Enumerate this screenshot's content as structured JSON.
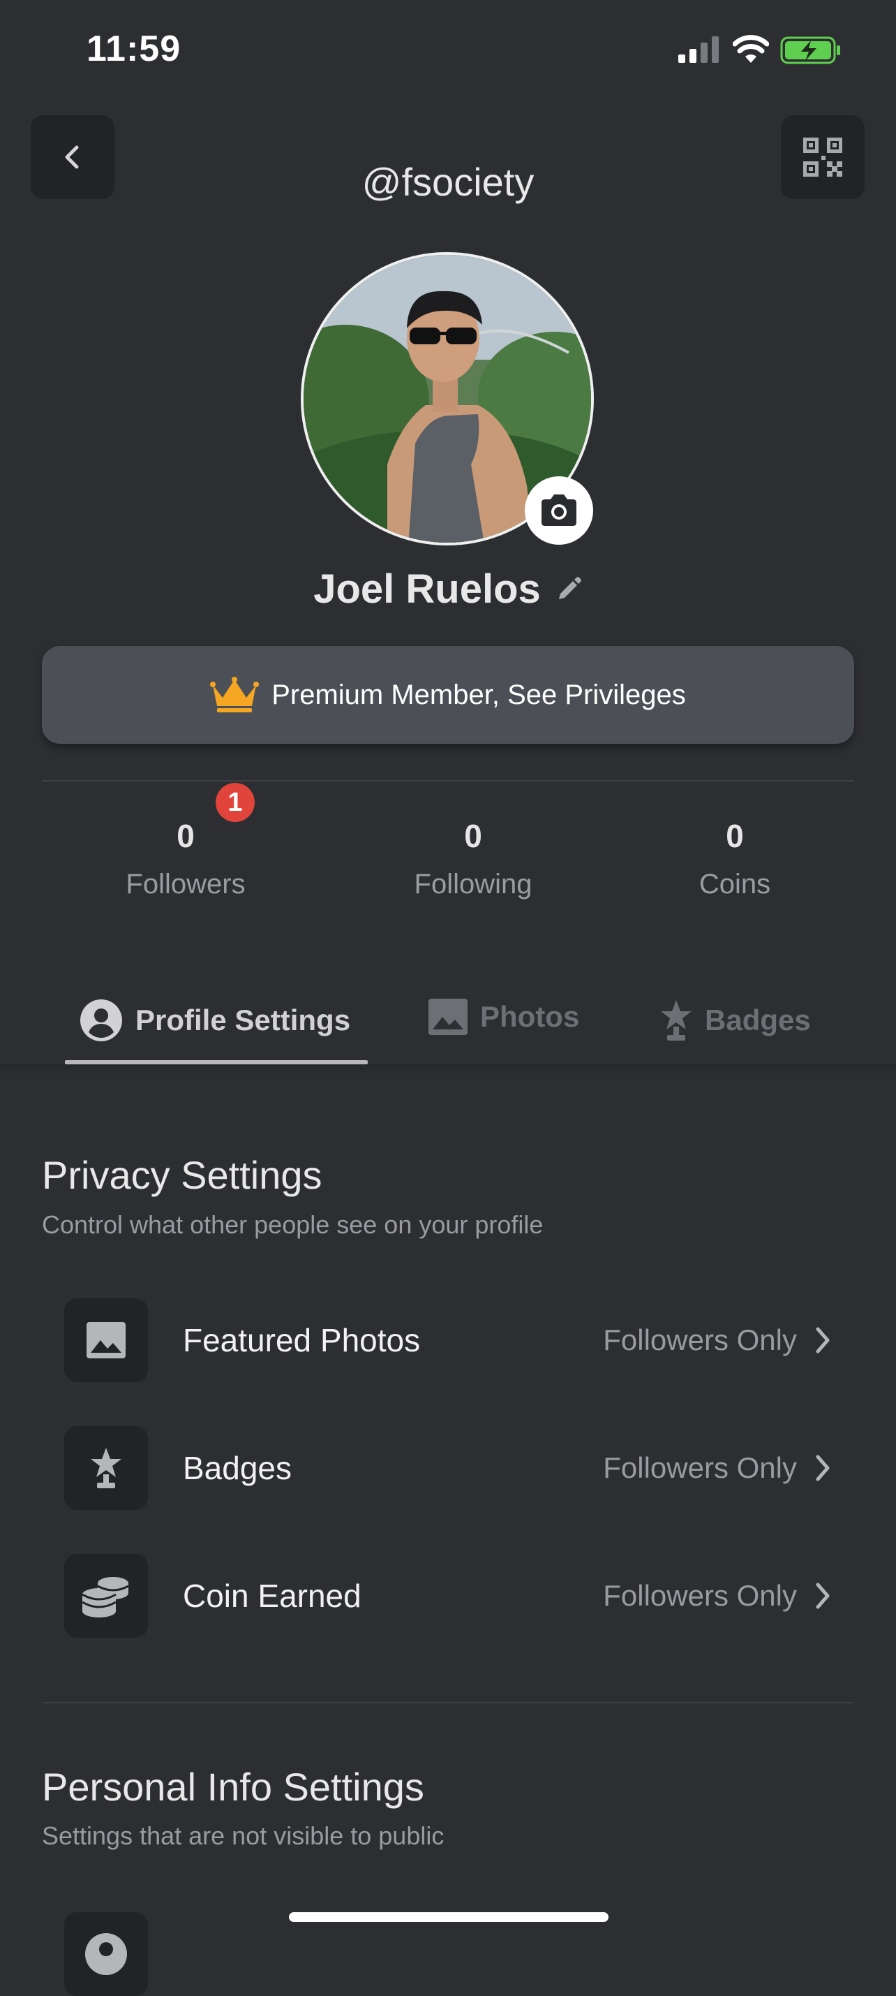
{
  "status_bar": {
    "time": "11:59"
  },
  "header": {
    "username": "@fsociety"
  },
  "profile": {
    "display_name": "Joel Ruelos"
  },
  "premium": {
    "label": "Premium Member, See Privileges"
  },
  "stats": {
    "notification_count": "1",
    "items": [
      {
        "value": "0",
        "label": "Followers"
      },
      {
        "value": "0",
        "label": "Following"
      },
      {
        "value": "0",
        "label": "Coins"
      }
    ]
  },
  "tabs": [
    {
      "label": "Profile Settings",
      "active": true
    },
    {
      "label": "Photos",
      "active": false
    },
    {
      "label": "Badges",
      "active": false
    }
  ],
  "privacy": {
    "title": "Privacy Settings",
    "subtitle": "Control what other people see on your profile",
    "rows": [
      {
        "icon": "image-icon",
        "label": "Featured Photos",
        "value": "Followers Only"
      },
      {
        "icon": "badge-icon",
        "label": "Badges",
        "value": "Followers Only"
      },
      {
        "icon": "coins-icon",
        "label": "Coin Earned",
        "value": "Followers Only"
      }
    ]
  },
  "personal": {
    "title": "Personal Info Settings",
    "subtitle": "Settings that are not visible to public"
  },
  "colors": {
    "background": "#2d2e32",
    "card": "#222326",
    "banner": "#4c4f56",
    "crown": "#f5a623",
    "badge": "#e0443a",
    "battery": "#5fcf4f"
  }
}
